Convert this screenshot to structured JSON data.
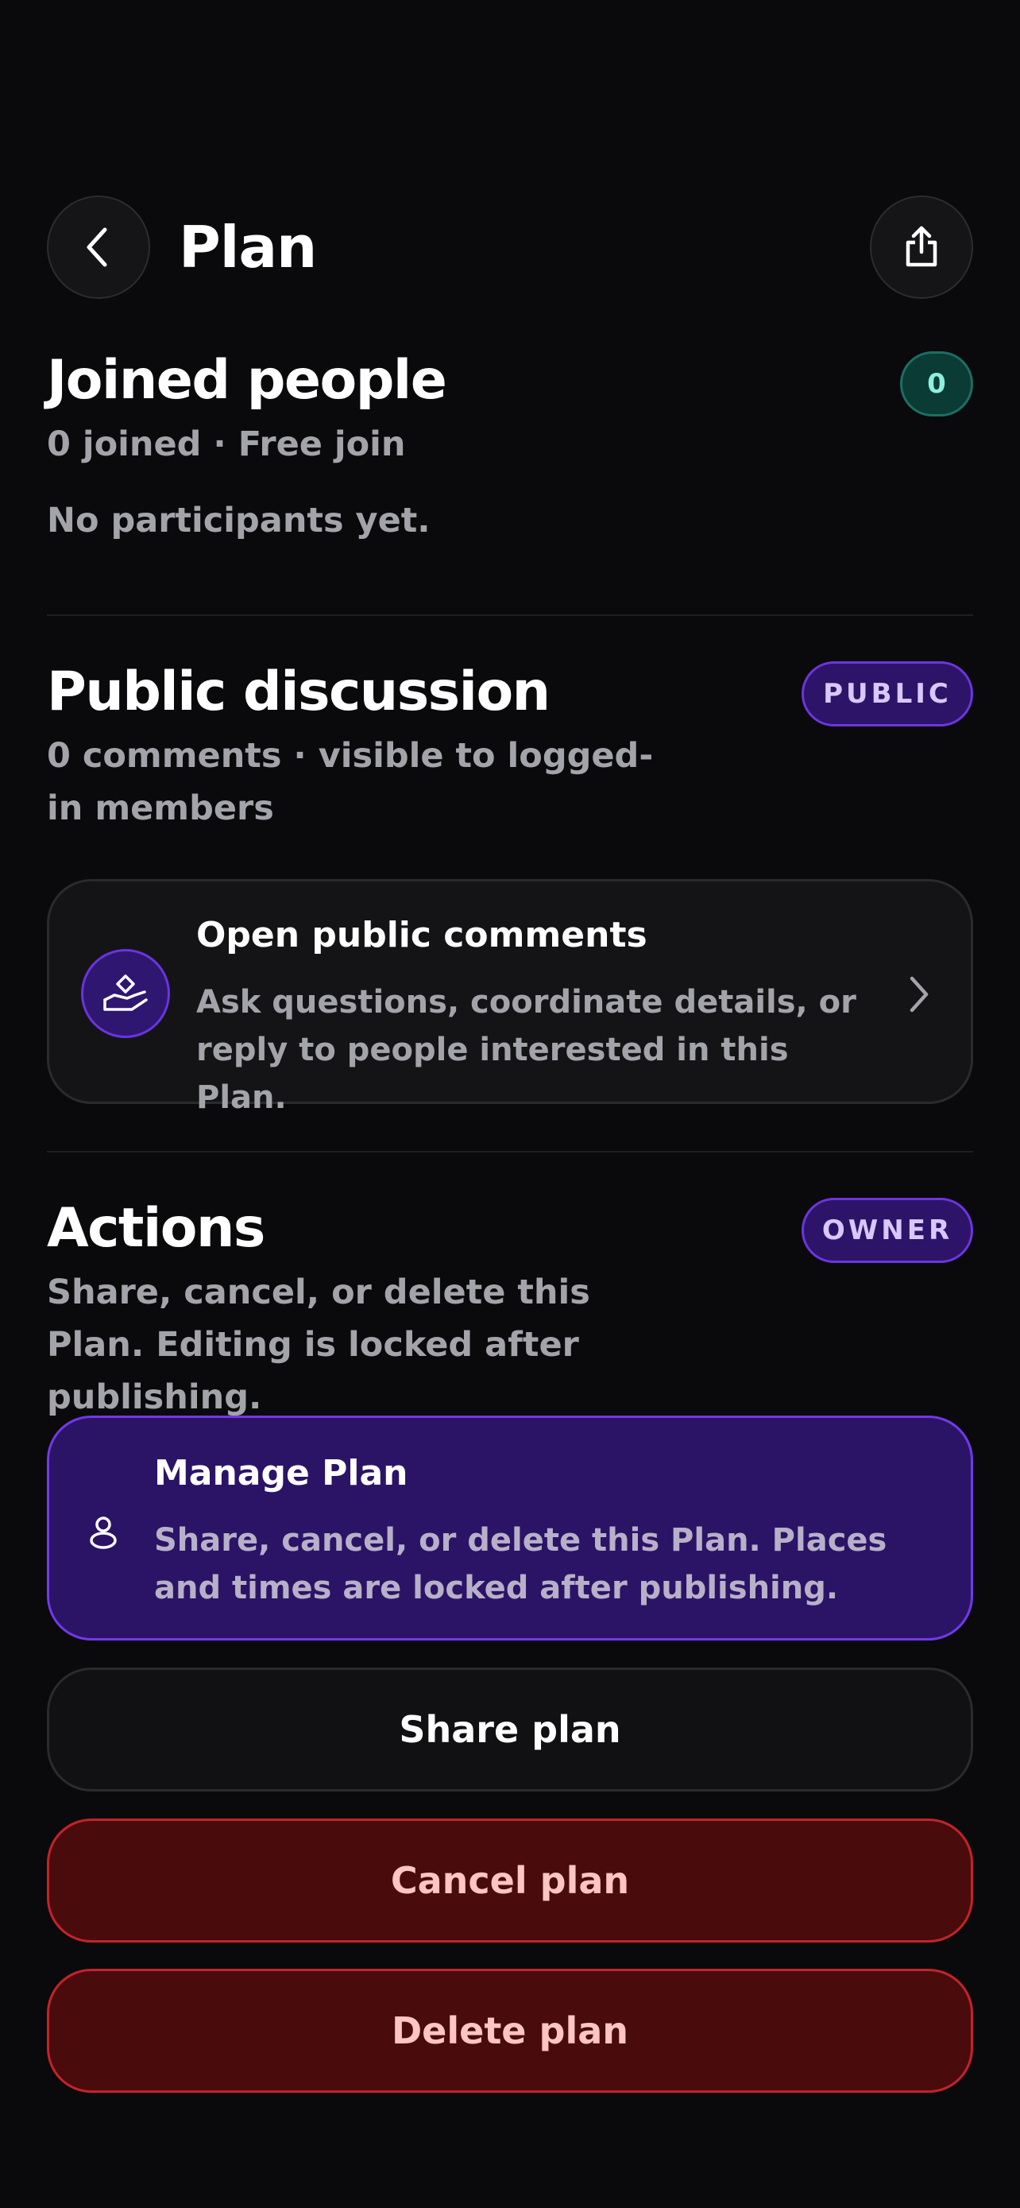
{
  "header": {
    "title": "Plan",
    "back_icon": "chevron-left-icon",
    "share_icon": "share-icon"
  },
  "joined": {
    "title": "Joined people",
    "count_badge": "0",
    "subtitle": "0 joined · Free join",
    "empty_text": "No participants yet."
  },
  "discussion": {
    "title": "Public discussion",
    "badge": "PUBLIC",
    "subtitle": "0 comments · visible to logged-in members",
    "card": {
      "title": "Open public comments",
      "description": "Ask questions, coordinate details, or reply to people interested in this Plan.",
      "icon": "hand-comment-icon"
    }
  },
  "actions": {
    "title": "Actions",
    "badge": "OWNER",
    "subtitle": "Share, cancel, or delete this Plan. Editing is locked after publishing.",
    "manage": {
      "title": "Manage Plan",
      "description": "Share, cancel, or delete this Plan. Places and times are locked after publishing.",
      "icon": "user-icon"
    },
    "share_label": "Share plan",
    "cancel_label": "Cancel plan",
    "delete_label": "Delete plan"
  },
  "colors": {
    "background": "#0a0a0c",
    "accent_purple": "#6d35e0",
    "danger_red": "#c4232a",
    "teal": "#1d6e63"
  }
}
